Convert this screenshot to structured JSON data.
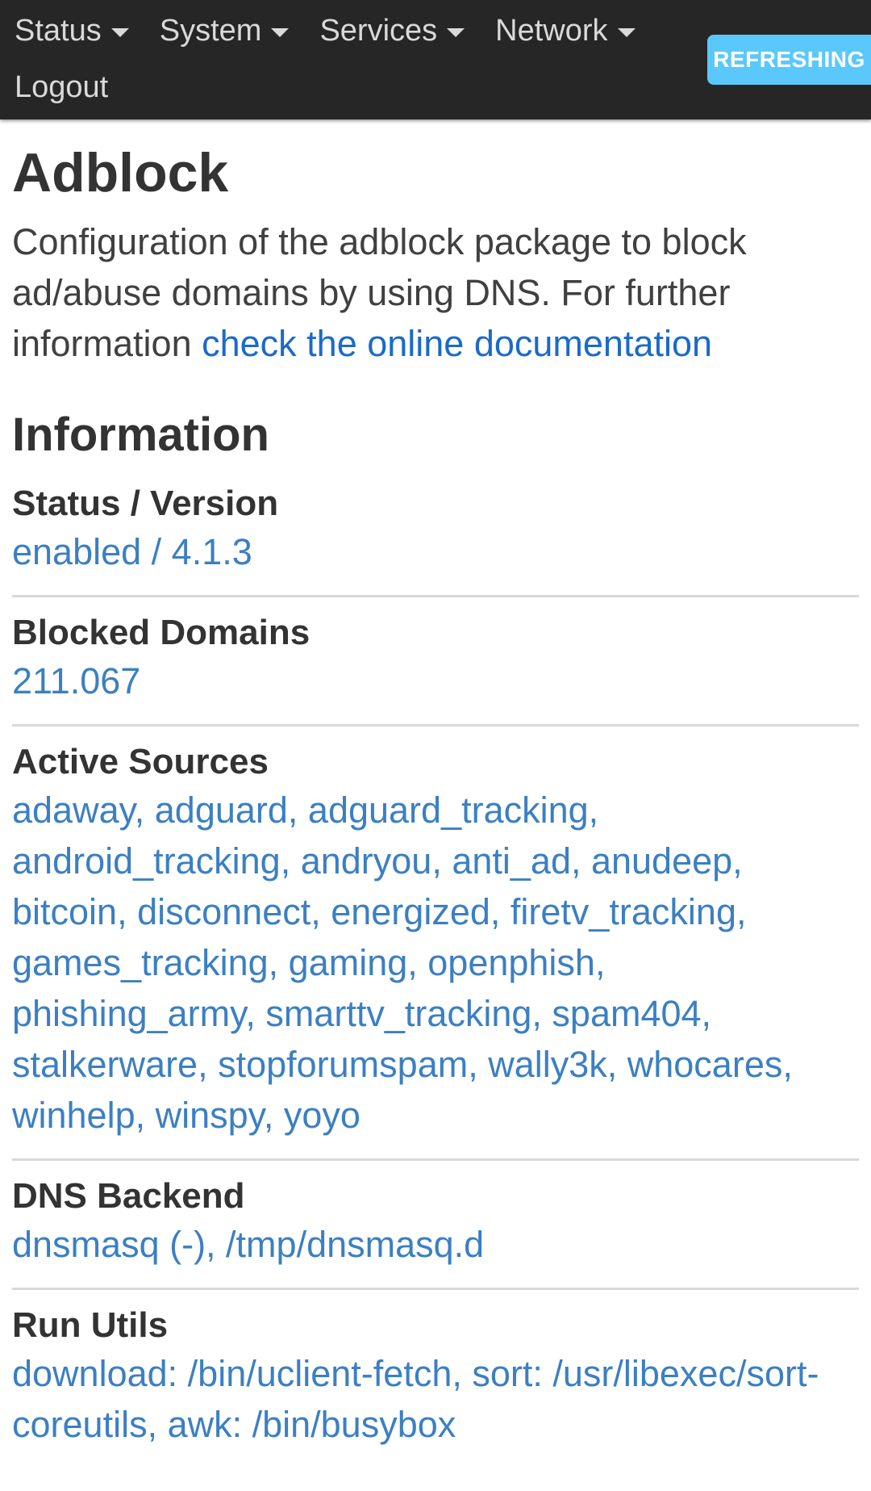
{
  "navbar": {
    "menus": [
      {
        "label": "Status"
      },
      {
        "label": "System"
      },
      {
        "label": "Services"
      },
      {
        "label": "Network"
      }
    ],
    "logout_label": "Logout",
    "refresh_badge": "REFRESHING"
  },
  "page": {
    "title": "Adblock",
    "description": "Configuration of the adblock package to block ad/abuse domains by using DNS. For further information ",
    "doc_link": "check the online documentation"
  },
  "information": {
    "title": "Information",
    "rows": [
      {
        "label": "Status / Version",
        "value": "enabled / 4.1.3"
      },
      {
        "label": "Blocked Domains",
        "value": "211.067"
      },
      {
        "label": "Active Sources",
        "value": "adaway, adguard, adguard_tracking, android_tracking, andryou, anti_ad, anudeep, bitcoin, disconnect, energized, firetv_tracking, games_tracking, gaming, openphish, phishing_army, smarttv_tracking, spam404, stalkerware, stopforumspam, wally3k, whocares, winhelp, winspy, yoyo"
      },
      {
        "label": "DNS Backend",
        "value": "dnsmasq (-), /tmp/dnsmasq.d"
      },
      {
        "label": "Run Utils",
        "value": "download: /bin/uclient-fetch, sort: /usr/libexec/sort-coreutils, awk: /bin/busybox"
      }
    ]
  },
  "colors": {
    "navbar_bg": "#262626",
    "badge_bg": "#5bc8fb",
    "link": "#1b6ac9",
    "value_text": "#3c7fc2"
  }
}
